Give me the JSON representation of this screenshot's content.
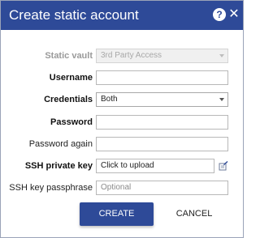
{
  "dialog": {
    "title": "Create static account",
    "help_icon": "help-icon",
    "close_icon": "close-icon",
    "help_glyph": "?",
    "close_glyph": "✕"
  },
  "form": {
    "static_vault": {
      "label": "Static vault",
      "value": "3rd Party Access",
      "disabled": true
    },
    "username": {
      "label": "Username",
      "value": ""
    },
    "credentials": {
      "label": "Credentials",
      "value": "Both"
    },
    "password": {
      "label": "Password",
      "value": ""
    },
    "password_again": {
      "label": "Password again",
      "value": ""
    },
    "ssh_private_key": {
      "label": "SSH private key",
      "value": "Click to upload",
      "icon": "upload-file-icon"
    },
    "ssh_key_passphrase": {
      "label": "SSH key passphrase",
      "placeholder": "Optional"
    }
  },
  "buttons": {
    "create": "CREATE",
    "cancel": "CANCEL"
  },
  "colors": {
    "primary": "#2e4a98",
    "border": "#b8b8b8",
    "disabled_text": "#a8a8a8"
  }
}
